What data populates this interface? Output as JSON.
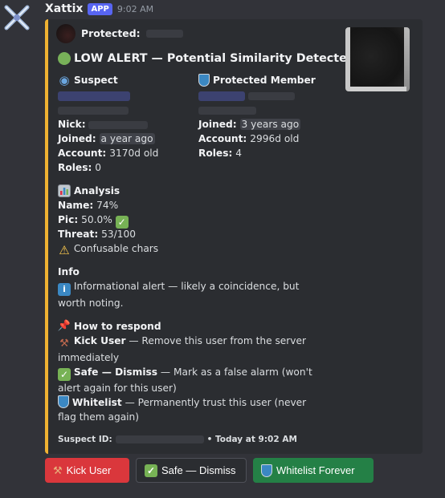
{
  "message": {
    "username": "Xattix",
    "badge": "APP",
    "timestamp": "9:02 AM"
  },
  "embed": {
    "accent_color": "#f0b232",
    "author": "Protected:",
    "title": "LOW ALERT — Potential Similarity Detected",
    "suspect": {
      "heading": "Suspect",
      "nick_label": "Nick:",
      "joined_label": "Joined:",
      "joined_value": "a year ago",
      "account_label": "Account:",
      "account_value": "3170d old",
      "roles_label": "Roles:",
      "roles_value": "0"
    },
    "protected": {
      "heading": "Protected Member",
      "joined_label": "Joined:",
      "joined_value": "3 years ago",
      "account_label": "Account:",
      "account_value": "2996d old",
      "roles_label": "Roles:",
      "roles_value": "4"
    },
    "analysis": {
      "heading": "Analysis",
      "name_label": "Name:",
      "name_value": "74%",
      "pic_label": "Pic:",
      "pic_value": "50.0%",
      "threat_label": "Threat:",
      "threat_value": "53/100",
      "confusable": "Confusable chars"
    },
    "info": {
      "heading": "Info",
      "text": "Informational alert — likely a coincidence, but worth noting."
    },
    "respond": {
      "heading": "How to respond",
      "kick_label": "Kick User",
      "kick_desc": " — Remove this user from the server immediately",
      "safe_label": "Safe — Dismiss",
      "safe_desc": " — Mark as a false alarm (won't alert again for this user)",
      "whitelist_label": "Whitelist",
      "whitelist_desc": " — Permanently trust this user (never flag them again)"
    },
    "footer": {
      "suspect_id_label": "Suspect ID:",
      "time": "• Today at 9:02 AM"
    }
  },
  "buttons": {
    "kick": "Kick User",
    "safe": "Safe — Dismiss",
    "whitelist": "Whitelist Forever"
  },
  "icons": {
    "avatar": "crossed-swords-icon",
    "suspect": "bust-in-silhouette-icon",
    "protected": "shield-icon",
    "analysis": "bar-chart-icon",
    "check": "check-mark-icon",
    "warning": "warning-icon",
    "info": "information-icon",
    "pin": "pushpin-icon",
    "hammer": "hammer-icon"
  }
}
